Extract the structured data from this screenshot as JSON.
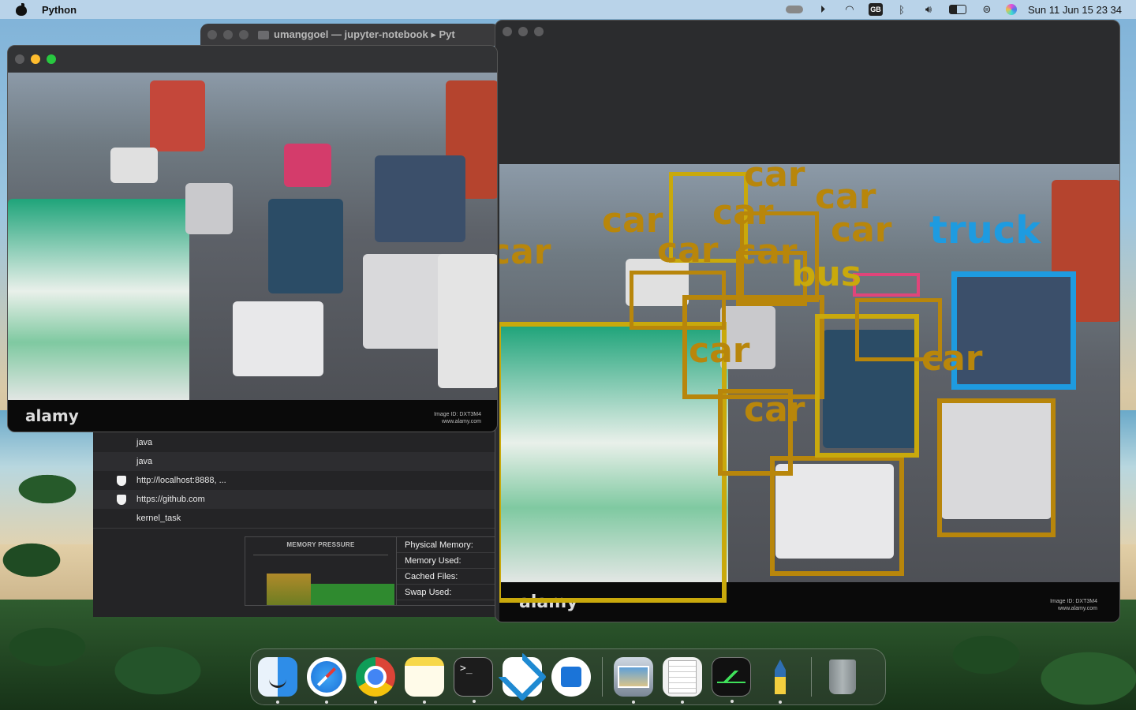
{
  "menubar": {
    "app_name": "Python",
    "input_badge": "GB",
    "clock": "Sun 11 Jun  15 23 34"
  },
  "terminal_window": {
    "title": "umanggoel — jupyter-notebook ▸ Pyt"
  },
  "activity_monitor": {
    "processes": [
      {
        "name": "java"
      },
      {
        "name": "java"
      },
      {
        "name": "http://localhost:8888, ..."
      },
      {
        "name": "https://github.com"
      },
      {
        "name": "kernel_task"
      }
    ],
    "memory_pressure_title": "MEMORY PRESSURE",
    "stats": [
      "Physical Memory:",
      "Memory Used:",
      "Cached Files:",
      "Swap Used:"
    ]
  },
  "original_image_window": {
    "watermark": "alamy",
    "watermark_small": "Image ID: DXT3M4\nwww.alamy.com"
  },
  "detection_window": {
    "watermark": "alamy",
    "watermark_small": "Image ID: DXT3M4\nwww.alamy.com",
    "labels": [
      "car",
      "car",
      "car",
      "car",
      "car",
      "truck",
      "car",
      "bus",
      "car",
      "car",
      "car",
      "car",
      "car"
    ],
    "colors": {
      "car": "#b8860b",
      "truck": "#1e9be0",
      "bus": "#c9a90c"
    }
  },
  "dock": {
    "items": [
      "Finder",
      "Safari",
      "Google Chrome",
      "Notes",
      "Terminal",
      "Visual Studio Code",
      "App Store",
      "Preview",
      "TextEdit",
      "Activity Monitor",
      "Python Launcher",
      "Trash"
    ]
  }
}
